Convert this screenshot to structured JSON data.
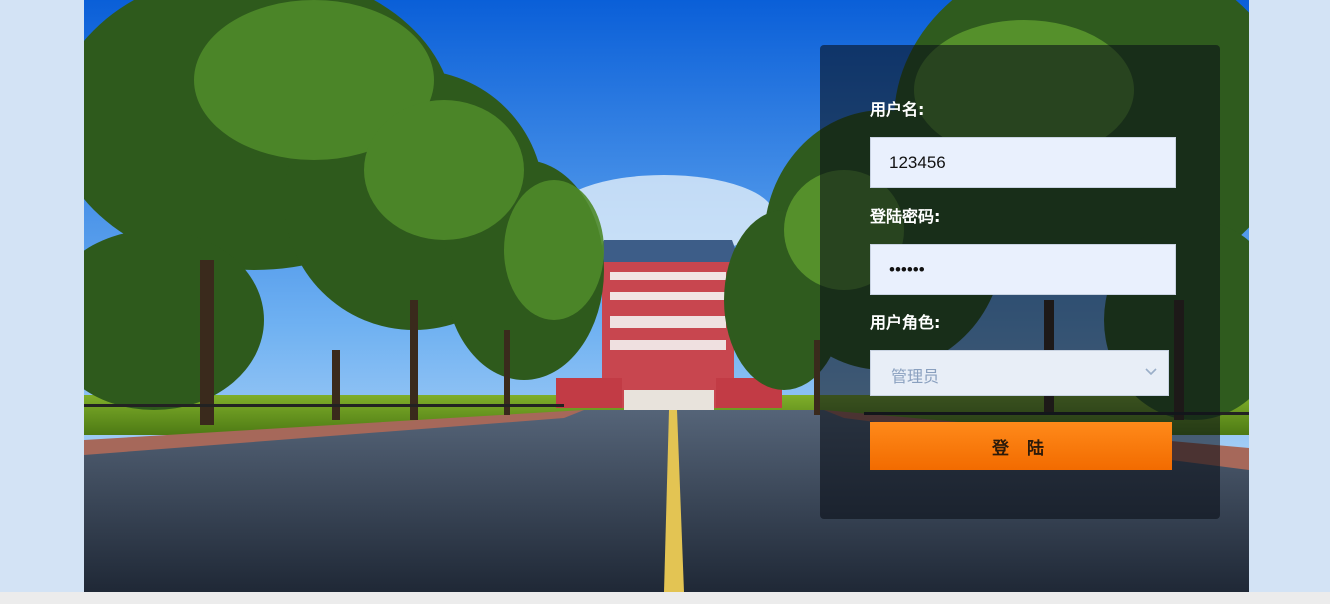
{
  "form": {
    "username_label": "用户名:",
    "username_value": "123456",
    "password_label": "登陆密码:",
    "password_value": "123456",
    "role_label": "用户角色:",
    "role_selected": "管理员",
    "login_button": "登 陆"
  },
  "colors": {
    "page_background": "#d3e3f5",
    "panel_overlay": "rgba(8,14,22,0.58)",
    "input_background": "#e9f0fd",
    "button_orange": "#ff7a00"
  },
  "icons": {
    "select_arrow": "chevron-down-icon"
  }
}
